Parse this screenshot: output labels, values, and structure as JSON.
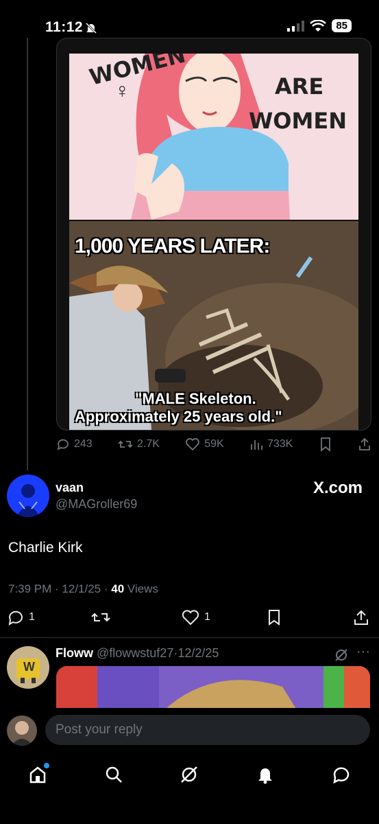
{
  "status_bar": {
    "time": "11:12",
    "battery": "85"
  },
  "meme": {
    "top_text_left": "WOMEN",
    "top_text_right_1": "ARE",
    "top_text_right_2": "WOMEN",
    "panel_caption": "1,000 YEARS LATER:",
    "bottom_caption_1": "\"MALE Skeleton.",
    "bottom_caption_2": "Approximately 25 years old.\""
  },
  "quoted_metrics": {
    "replies": "243",
    "reposts": "2.7K",
    "likes": "59K",
    "views": "733K"
  },
  "reply": {
    "name": "vaan",
    "handle": "@MAGroller69",
    "badge": "X.com",
    "text": "Charlie Kirk",
    "time": "7:39 PM",
    "date": "12/1/25",
    "views_count": "40",
    "views_label": "Views",
    "reply_count": "1",
    "like_count": "1"
  },
  "next_reply": {
    "name": "Floww",
    "handle": "@flowwstuf27",
    "date": "12/2/25",
    "avatar_letter": "W"
  },
  "composer": {
    "placeholder": "Post your reply"
  },
  "colors": {
    "background": "#000000",
    "muted": "#71767b",
    "text": "#e7e9ea",
    "accent": "#1d9bf0"
  }
}
